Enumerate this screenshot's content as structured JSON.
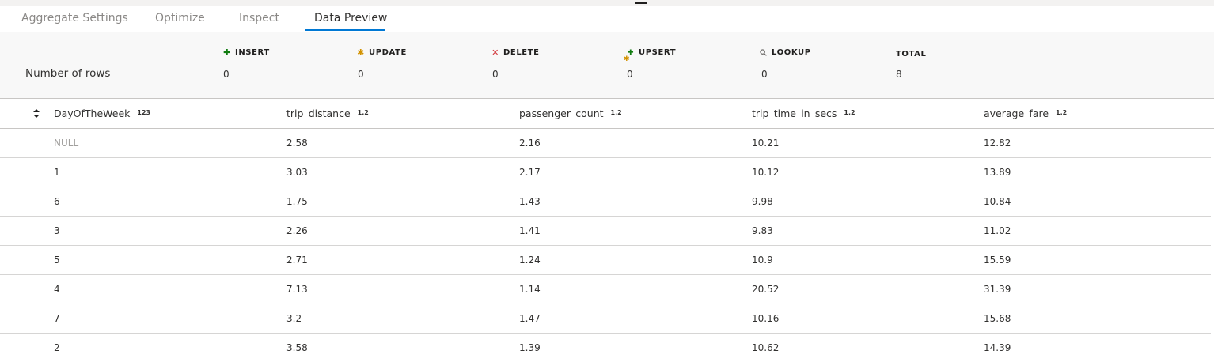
{
  "tabs": [
    {
      "label": "Aggregate Settings"
    },
    {
      "label": "Optimize"
    },
    {
      "label": "Inspect"
    },
    {
      "label": "Data Preview"
    }
  ],
  "active_tab": "Data Preview",
  "summary": {
    "rows_label": "Number of rows",
    "stats": [
      {
        "label": "INSERT",
        "value": "0",
        "icon": "plus-icon",
        "color": "#107c10"
      },
      {
        "label": "UPDATE",
        "value": "0",
        "icon": "asterisk-icon",
        "color": "#d29200"
      },
      {
        "label": "DELETE",
        "value": "0",
        "icon": "x-icon",
        "color": "#d13438"
      },
      {
        "label": "UPSERT",
        "value": "0",
        "icon": "upsert-icon",
        "color": "#107c10"
      },
      {
        "label": "LOOKUP",
        "value": "0",
        "icon": "search-icon",
        "color": "#605e5c"
      },
      {
        "label": "TOTAL",
        "value": "8"
      }
    ]
  },
  "table": {
    "columns": [
      {
        "name": "DayOfTheWeek",
        "type": "123"
      },
      {
        "name": "trip_distance",
        "type": "1.2"
      },
      {
        "name": "passenger_count",
        "type": "1.2"
      },
      {
        "name": "trip_time_in_secs",
        "type": "1.2"
      },
      {
        "name": "average_fare",
        "type": "1.2"
      }
    ],
    "rows": [
      [
        "NULL",
        "2.58",
        "2.16",
        "10.21",
        "12.82"
      ],
      [
        "1",
        "3.03",
        "2.17",
        "10.12",
        "13.89"
      ],
      [
        "6",
        "1.75",
        "1.43",
        "9.98",
        "10.84"
      ],
      [
        "3",
        "2.26",
        "1.41",
        "9.83",
        "11.02"
      ],
      [
        "5",
        "2.71",
        "1.24",
        "10.9",
        "15.59"
      ],
      [
        "4",
        "7.13",
        "1.14",
        "20.52",
        "31.39"
      ],
      [
        "7",
        "3.2",
        "1.47",
        "10.16",
        "15.68"
      ],
      [
        "2",
        "3.58",
        "1.39",
        "10.62",
        "14.39"
      ]
    ]
  },
  "colors": {
    "accent": "#0078d4",
    "null_text": "#a19f9d"
  }
}
